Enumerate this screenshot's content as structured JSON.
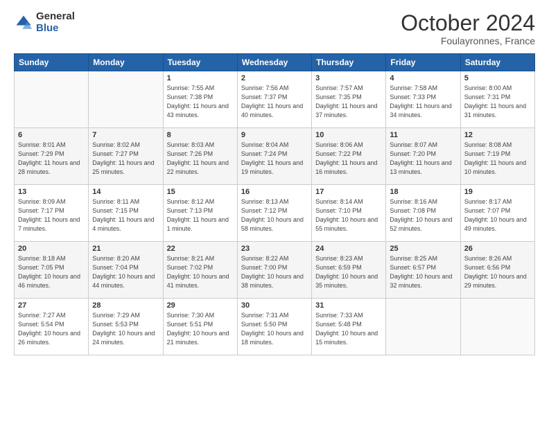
{
  "logo": {
    "general": "General",
    "blue": "Blue"
  },
  "title": "October 2024",
  "location": "Foulayronnes, France",
  "weekdays": [
    "Sunday",
    "Monday",
    "Tuesday",
    "Wednesday",
    "Thursday",
    "Friday",
    "Saturday"
  ],
  "weeks": [
    [
      {
        "day": "",
        "sunrise": "",
        "sunset": "",
        "daylight": ""
      },
      {
        "day": "",
        "sunrise": "",
        "sunset": "",
        "daylight": ""
      },
      {
        "day": "1",
        "sunrise": "Sunrise: 7:55 AM",
        "sunset": "Sunset: 7:38 PM",
        "daylight": "Daylight: 11 hours and 43 minutes."
      },
      {
        "day": "2",
        "sunrise": "Sunrise: 7:56 AM",
        "sunset": "Sunset: 7:37 PM",
        "daylight": "Daylight: 11 hours and 40 minutes."
      },
      {
        "day": "3",
        "sunrise": "Sunrise: 7:57 AM",
        "sunset": "Sunset: 7:35 PM",
        "daylight": "Daylight: 11 hours and 37 minutes."
      },
      {
        "day": "4",
        "sunrise": "Sunrise: 7:58 AM",
        "sunset": "Sunset: 7:33 PM",
        "daylight": "Daylight: 11 hours and 34 minutes."
      },
      {
        "day": "5",
        "sunrise": "Sunrise: 8:00 AM",
        "sunset": "Sunset: 7:31 PM",
        "daylight": "Daylight: 11 hours and 31 minutes."
      }
    ],
    [
      {
        "day": "6",
        "sunrise": "Sunrise: 8:01 AM",
        "sunset": "Sunset: 7:29 PM",
        "daylight": "Daylight: 11 hours and 28 minutes."
      },
      {
        "day": "7",
        "sunrise": "Sunrise: 8:02 AM",
        "sunset": "Sunset: 7:27 PM",
        "daylight": "Daylight: 11 hours and 25 minutes."
      },
      {
        "day": "8",
        "sunrise": "Sunrise: 8:03 AM",
        "sunset": "Sunset: 7:26 PM",
        "daylight": "Daylight: 11 hours and 22 minutes."
      },
      {
        "day": "9",
        "sunrise": "Sunrise: 8:04 AM",
        "sunset": "Sunset: 7:24 PM",
        "daylight": "Daylight: 11 hours and 19 minutes."
      },
      {
        "day": "10",
        "sunrise": "Sunrise: 8:06 AM",
        "sunset": "Sunset: 7:22 PM",
        "daylight": "Daylight: 11 hours and 16 minutes."
      },
      {
        "day": "11",
        "sunrise": "Sunrise: 8:07 AM",
        "sunset": "Sunset: 7:20 PM",
        "daylight": "Daylight: 11 hours and 13 minutes."
      },
      {
        "day": "12",
        "sunrise": "Sunrise: 8:08 AM",
        "sunset": "Sunset: 7:19 PM",
        "daylight": "Daylight: 11 hours and 10 minutes."
      }
    ],
    [
      {
        "day": "13",
        "sunrise": "Sunrise: 8:09 AM",
        "sunset": "Sunset: 7:17 PM",
        "daylight": "Daylight: 11 hours and 7 minutes."
      },
      {
        "day": "14",
        "sunrise": "Sunrise: 8:11 AM",
        "sunset": "Sunset: 7:15 PM",
        "daylight": "Daylight: 11 hours and 4 minutes."
      },
      {
        "day": "15",
        "sunrise": "Sunrise: 8:12 AM",
        "sunset": "Sunset: 7:13 PM",
        "daylight": "Daylight: 11 hours and 1 minute."
      },
      {
        "day": "16",
        "sunrise": "Sunrise: 8:13 AM",
        "sunset": "Sunset: 7:12 PM",
        "daylight": "Daylight: 10 hours and 58 minutes."
      },
      {
        "day": "17",
        "sunrise": "Sunrise: 8:14 AM",
        "sunset": "Sunset: 7:10 PM",
        "daylight": "Daylight: 10 hours and 55 minutes."
      },
      {
        "day": "18",
        "sunrise": "Sunrise: 8:16 AM",
        "sunset": "Sunset: 7:08 PM",
        "daylight": "Daylight: 10 hours and 52 minutes."
      },
      {
        "day": "19",
        "sunrise": "Sunrise: 8:17 AM",
        "sunset": "Sunset: 7:07 PM",
        "daylight": "Daylight: 10 hours and 49 minutes."
      }
    ],
    [
      {
        "day": "20",
        "sunrise": "Sunrise: 8:18 AM",
        "sunset": "Sunset: 7:05 PM",
        "daylight": "Daylight: 10 hours and 46 minutes."
      },
      {
        "day": "21",
        "sunrise": "Sunrise: 8:20 AM",
        "sunset": "Sunset: 7:04 PM",
        "daylight": "Daylight: 10 hours and 44 minutes."
      },
      {
        "day": "22",
        "sunrise": "Sunrise: 8:21 AM",
        "sunset": "Sunset: 7:02 PM",
        "daylight": "Daylight: 10 hours and 41 minutes."
      },
      {
        "day": "23",
        "sunrise": "Sunrise: 8:22 AM",
        "sunset": "Sunset: 7:00 PM",
        "daylight": "Daylight: 10 hours and 38 minutes."
      },
      {
        "day": "24",
        "sunrise": "Sunrise: 8:23 AM",
        "sunset": "Sunset: 6:59 PM",
        "daylight": "Daylight: 10 hours and 35 minutes."
      },
      {
        "day": "25",
        "sunrise": "Sunrise: 8:25 AM",
        "sunset": "Sunset: 6:57 PM",
        "daylight": "Daylight: 10 hours and 32 minutes."
      },
      {
        "day": "26",
        "sunrise": "Sunrise: 8:26 AM",
        "sunset": "Sunset: 6:56 PM",
        "daylight": "Daylight: 10 hours and 29 minutes."
      }
    ],
    [
      {
        "day": "27",
        "sunrise": "Sunrise: 7:27 AM",
        "sunset": "Sunset: 5:54 PM",
        "daylight": "Daylight: 10 hours and 26 minutes."
      },
      {
        "day": "28",
        "sunrise": "Sunrise: 7:29 AM",
        "sunset": "Sunset: 5:53 PM",
        "daylight": "Daylight: 10 hours and 24 minutes."
      },
      {
        "day": "29",
        "sunrise": "Sunrise: 7:30 AM",
        "sunset": "Sunset: 5:51 PM",
        "daylight": "Daylight: 10 hours and 21 minutes."
      },
      {
        "day": "30",
        "sunrise": "Sunrise: 7:31 AM",
        "sunset": "Sunset: 5:50 PM",
        "daylight": "Daylight: 10 hours and 18 minutes."
      },
      {
        "day": "31",
        "sunrise": "Sunrise: 7:33 AM",
        "sunset": "Sunset: 5:48 PM",
        "daylight": "Daylight: 10 hours and 15 minutes."
      },
      {
        "day": "",
        "sunrise": "",
        "sunset": "",
        "daylight": ""
      },
      {
        "day": "",
        "sunrise": "",
        "sunset": "",
        "daylight": ""
      }
    ]
  ]
}
